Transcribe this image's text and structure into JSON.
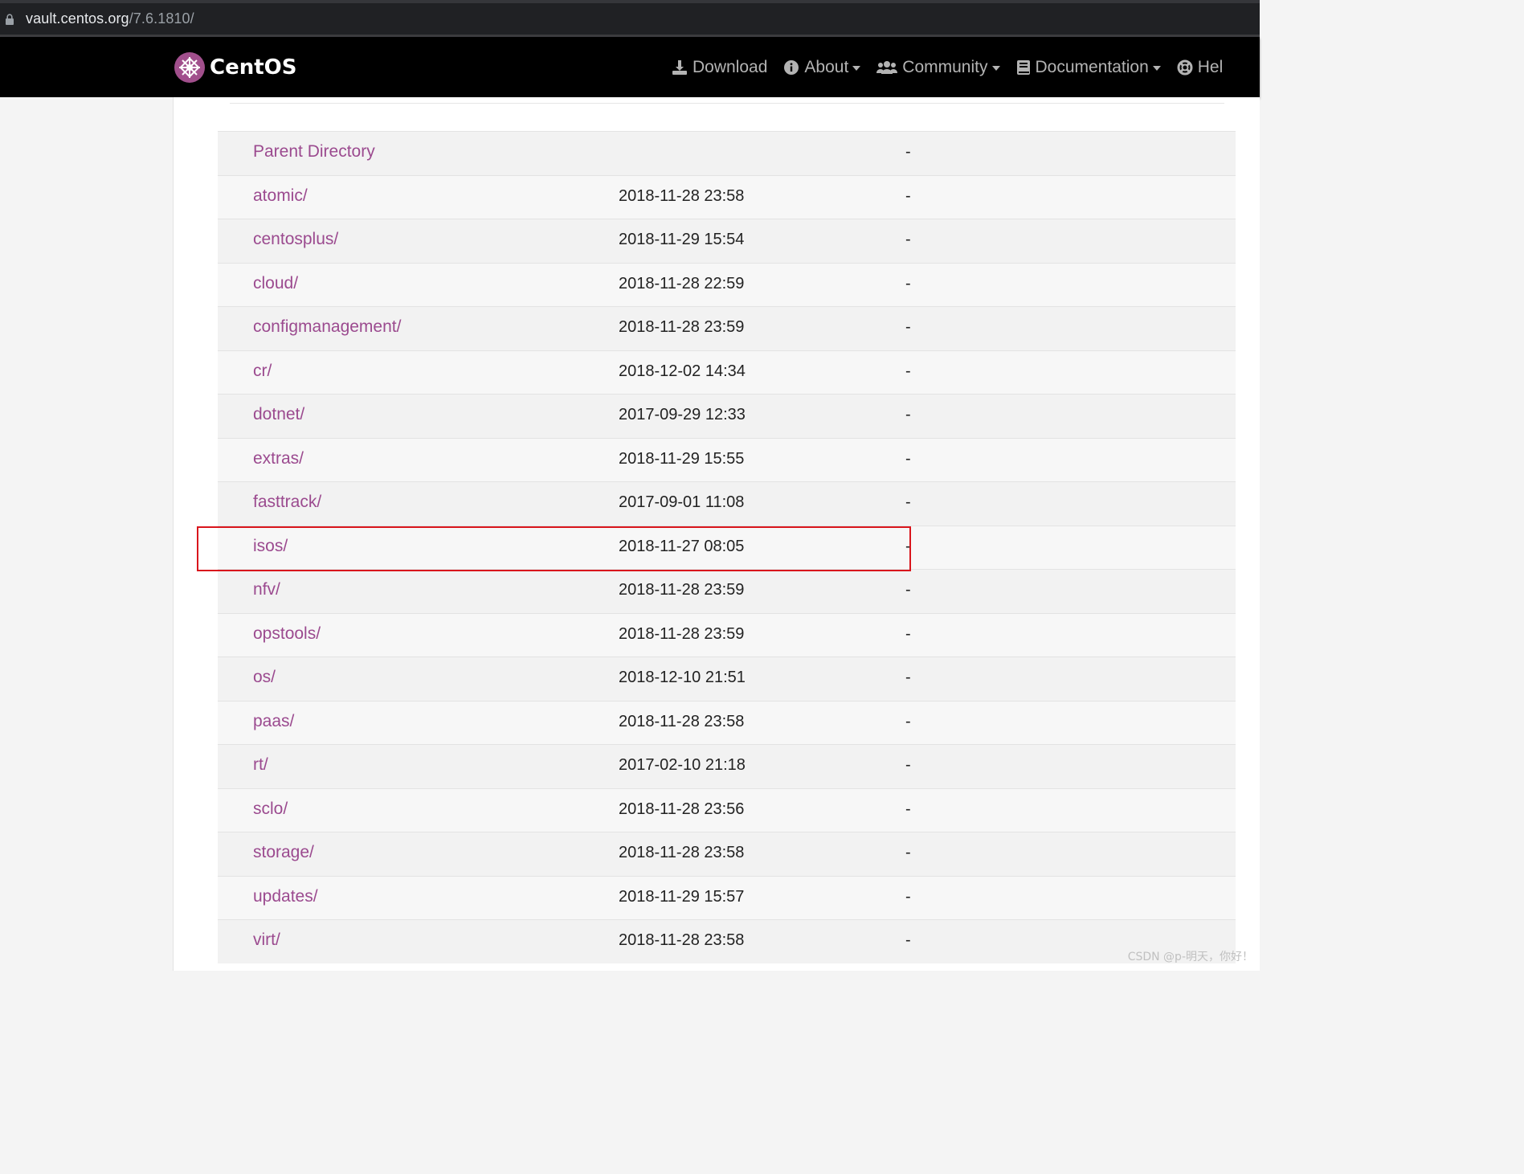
{
  "browser": {
    "url_host": "vault.centos.org",
    "url_path": "/7.6.1810/"
  },
  "navbar": {
    "brand": "CentOS",
    "links": {
      "download": "Download",
      "about": "About",
      "community": "Community",
      "documentation": "Documentation",
      "help": "Hel"
    }
  },
  "listing": {
    "rows": [
      {
        "name": "Parent Directory",
        "date": "",
        "size": "-"
      },
      {
        "name": "atomic/",
        "date": "2018-11-28 23:58",
        "size": "-"
      },
      {
        "name": "centosplus/",
        "date": "2018-11-29 15:54",
        "size": "-"
      },
      {
        "name": "cloud/",
        "date": "2018-11-28 22:59",
        "size": "-"
      },
      {
        "name": "configmanagement/",
        "date": "2018-11-28 23:59",
        "size": "-"
      },
      {
        "name": "cr/",
        "date": "2018-12-02 14:34",
        "size": "-"
      },
      {
        "name": "dotnet/",
        "date": "2017-09-29 12:33",
        "size": "-"
      },
      {
        "name": "extras/",
        "date": "2018-11-29 15:55",
        "size": "-"
      },
      {
        "name": "fasttrack/",
        "date": "2017-09-01 11:08",
        "size": "-"
      },
      {
        "name": "isos/",
        "date": "2018-11-27 08:05",
        "size": "-"
      },
      {
        "name": "nfv/",
        "date": "2018-11-28 23:59",
        "size": "-"
      },
      {
        "name": "opstools/",
        "date": "2018-11-28 23:59",
        "size": "-"
      },
      {
        "name": "os/",
        "date": "2018-12-10 21:51",
        "size": "-"
      },
      {
        "name": "paas/",
        "date": "2018-11-28 23:58",
        "size": "-"
      },
      {
        "name": "rt/",
        "date": "2017-02-10 21:18",
        "size": "-"
      },
      {
        "name": "sclo/",
        "date": "2018-11-28 23:56",
        "size": "-"
      },
      {
        "name": "storage/",
        "date": "2018-11-28 23:58",
        "size": "-"
      },
      {
        "name": "updates/",
        "date": "2018-11-29 15:57",
        "size": "-"
      },
      {
        "name": "virt/",
        "date": "2018-11-28 23:58",
        "size": "-"
      }
    ]
  },
  "watermark": "CSDN @p-明天，你好！",
  "colors": {
    "link": "#9b4a8f",
    "highlight_border": "#d9151c",
    "navbar_bg": "#000000"
  }
}
